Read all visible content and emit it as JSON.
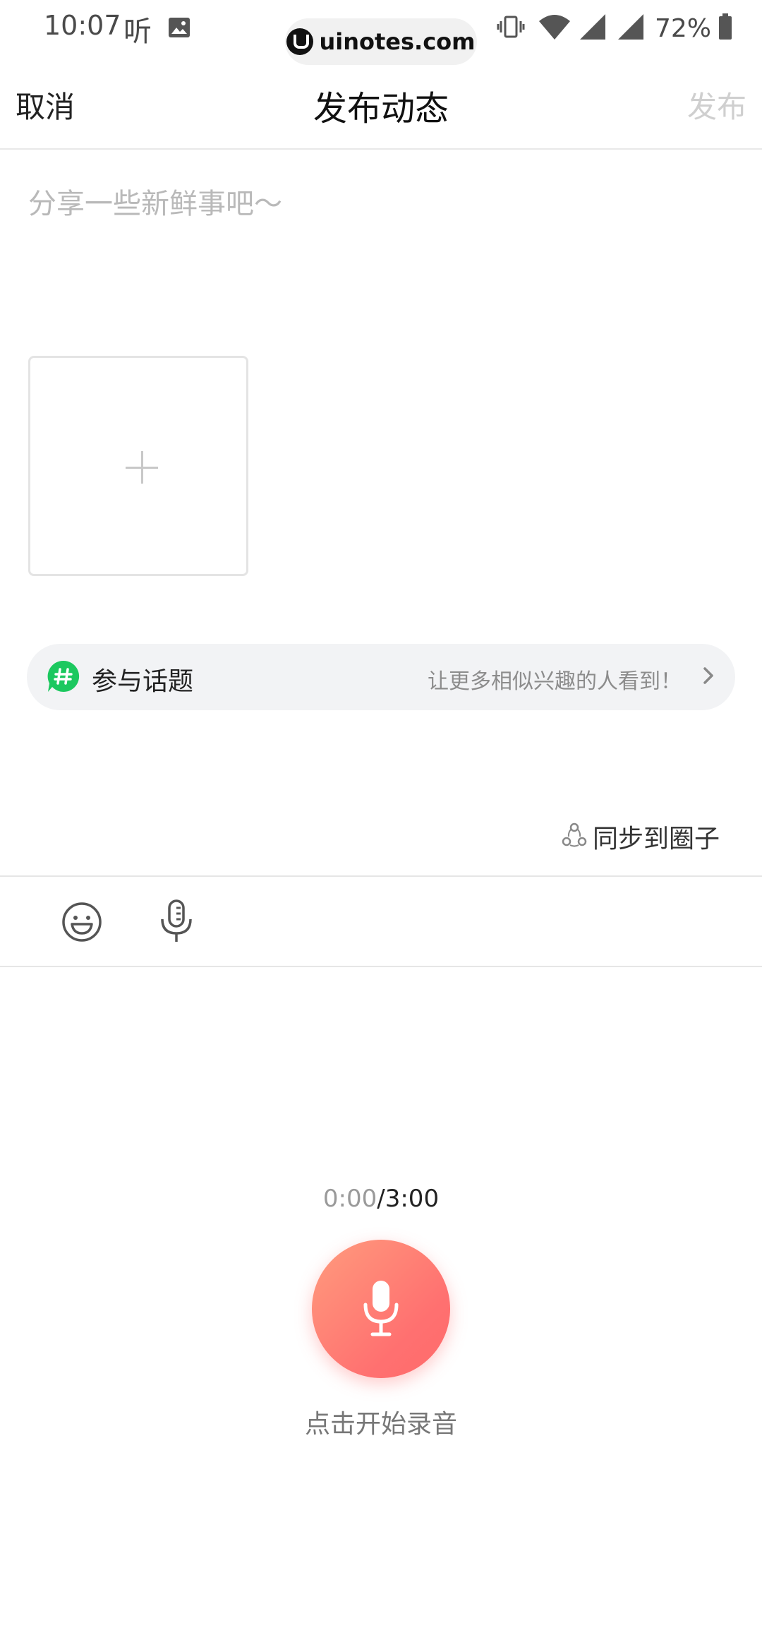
{
  "status_bar": {
    "time": "10:07",
    "ting_icon_text": "听",
    "battery": "72%",
    "watermark": "uinotes.com",
    "icons": [
      "gallery-icon",
      "vibrate-icon",
      "wifi-icon",
      "signal-icon",
      "signal-icon",
      "battery-icon"
    ]
  },
  "header": {
    "cancel": "取消",
    "title": "发布动态",
    "publish": "发布"
  },
  "composer": {
    "placeholder": "分享一些新鲜事吧～",
    "add_image_icon": "plus-icon"
  },
  "topic": {
    "label": "参与话题",
    "hint": "让更多相似兴趣的人看到！",
    "icon": "hashtag-icon",
    "accent": "#1cc85f"
  },
  "sync": {
    "label": "同步到圈子",
    "icon": "circle-group-icon"
  },
  "toolbar": {
    "icons": [
      "emoji-icon",
      "microphone-icon"
    ]
  },
  "recorder": {
    "elapsed": "0:00",
    "total": "/3:00",
    "hint": "点击开始录音",
    "gradient_start": "#ff9b7d",
    "gradient_end": "#ff6b6b"
  }
}
